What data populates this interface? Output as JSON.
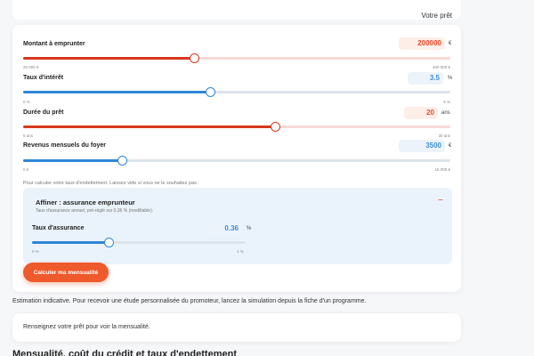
{
  "header": {
    "title": "Votre prêt"
  },
  "form": {
    "loan": {
      "label": "Montant à emprunter",
      "value": "200000",
      "unit": "€",
      "min": "20 000 €",
      "max": "400 000 €",
      "fraction": 0.4
    },
    "rate": {
      "label": "Taux d'intérêt",
      "value": "3.5",
      "unit": "%",
      "min": "0 %",
      "max": "8 %",
      "fraction": 0.4375
    },
    "duration": {
      "label": "Durée du prêt",
      "value": "20",
      "unit": "ans",
      "min": "5 ans",
      "max": "30 ans",
      "fraction": 0.59
    },
    "income": {
      "label": "Revenus mensuels du foyer",
      "value": "3500",
      "unit": "€",
      "min": "0 €",
      "max": "15 000 €",
      "fraction": 0.233
    },
    "hint": "Pour calculer votre taux d'endettement. Laissez vide si vous ne le souhaitez pas."
  },
  "insurance": {
    "title": "Affiner : assurance emprunteur",
    "subtitle": "Taux d'assurance annuel, pré-réglé sur 0,36 % (modifiable).",
    "collapse_symbol": "−",
    "rate": {
      "label": "Taux d'assurance",
      "value": "0.36",
      "unit": "%",
      "min": "0 %",
      "max": "1 %",
      "fraction": 0.36
    }
  },
  "actions": {
    "calculate_label": "Calculer ma mensualité"
  },
  "estimation_note": "Estimation indicative. Pour recevoir une étude personnalisée du promoteur, lancez la simulation depuis la fiche d'un programme.",
  "result": {
    "placeholder": "Renseignez votre prêt pour voir la mensualité."
  },
  "section": {
    "heading": "Mensualité, coût du crédit et taux d'endettement"
  },
  "colors": {
    "accent_orange": "#e8492b",
    "accent_blue": "#2f86d8"
  }
}
